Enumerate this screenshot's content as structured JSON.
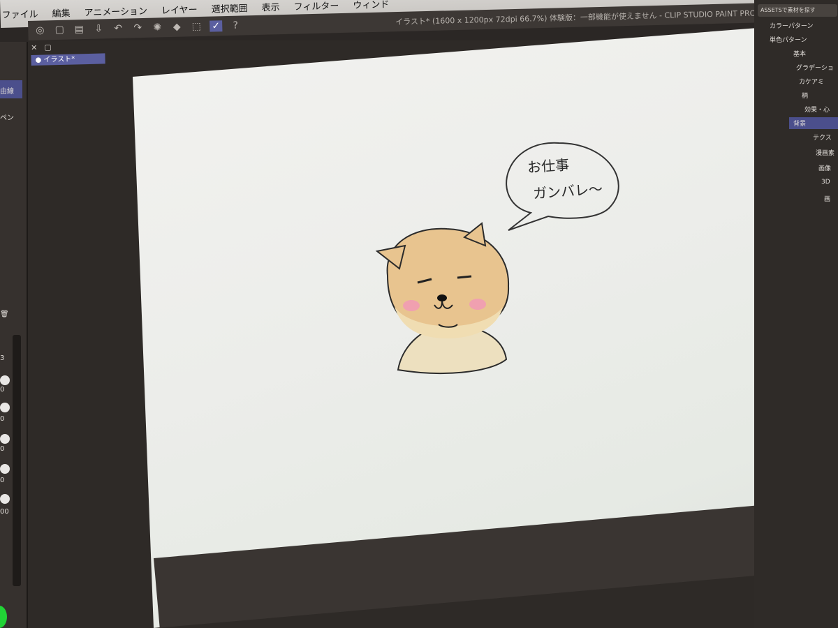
{
  "menu": [
    "ファイル",
    "編集",
    "アニメーション",
    "レイヤー",
    "選択範囲",
    "表示",
    "フィルター",
    "ウィンド"
  ],
  "toolbar": {
    "icons": [
      "app-icon",
      "new-file-icon",
      "open-icon",
      "save-icon",
      "undo-icon",
      "redo-icon",
      "spinner-icon",
      "transform-icon",
      "crop-icon",
      "pen-tool-icon",
      "help-icon"
    ],
    "title": "イラスト* (1600 x 1200px 72dpi 66.7%) 体験版：一部機能が使えません - CLIP STUDIO PAINT PRO"
  },
  "doc_tab": {
    "label": "● イラスト*"
  },
  "left_panel": {
    "labels": [
      "由線",
      "ペン"
    ],
    "brush_sizes": [
      "0",
      "0",
      "0",
      "0",
      "00"
    ],
    "top_number": "3"
  },
  "canvas": {
    "speech_line1": "お仕事",
    "speech_line2": "ガンバレ～"
  },
  "materials": {
    "search": "ASSETSで素材を探す",
    "items": [
      "カラーパターン",
      "単色パターン",
      "基本",
      "グラデーショ",
      "カケアミ",
      "柄",
      "効果・心",
      "背景",
      "テクス",
      "漫画素",
      "画像",
      "3D",
      "画"
    ],
    "selected": "背景"
  },
  "colors": {
    "accent": "#4b4f8c",
    "fur": "#e8c48f",
    "cheek": "#f0a0b0",
    "canvas": "#eeeeeb"
  }
}
